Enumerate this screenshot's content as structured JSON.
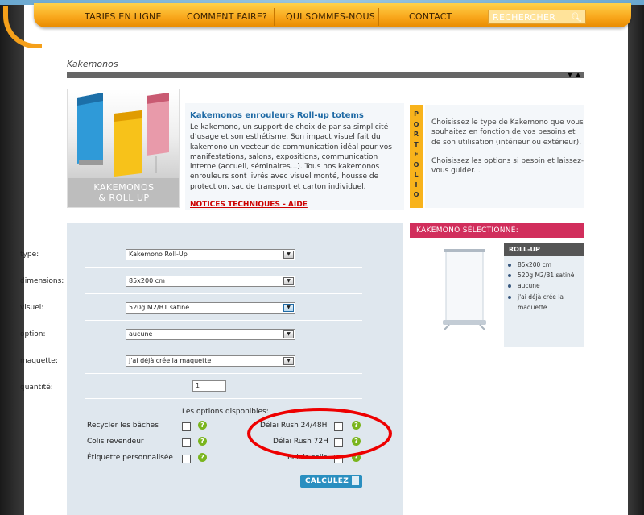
{
  "nav": {
    "items": [
      "TARIFS EN LIGNE",
      "COMMENT FAIRE?",
      "QUI SOMMES-NOUS",
      "CONTACT"
    ],
    "search_placeholder": "RECHERCHER"
  },
  "breadcrumb": "Kakemonos",
  "hero": {
    "caption_line1": "KAKEMONOS",
    "caption_line2": "& ROLL UP"
  },
  "description": {
    "title": "Kakemonos enrouleurs Roll-up totems",
    "body": "Le kakemono, un support de choix de par sa simplicité d’usage et son esthétisme. Son impact visuel fait du kakemono un vecteur de communication idéal pour vos manifestations, salons, expositions, communication interne (accueil, séminaires...). Tous nos kakemonos enrouleurs sont livrés avec visuel monté, housse de protection, sac de transport et carton individuel.",
    "link": "NOTICES TECHNIQUES - AIDE"
  },
  "portfolio_letters": [
    "P",
    "O",
    "R",
    "T",
    "F",
    "O",
    "L",
    "I",
    "O"
  ],
  "help": {
    "p1": "Choisissez le type de Kakemono que vous souhaitez en fonction de vos besoins et de son utilisation (intérieur ou extérieur).",
    "p2": "Choisissez les options si besoin et laissez-vous guider..."
  },
  "form": {
    "fields": [
      {
        "label": "type:",
        "value": "Kakemono Roll-Up"
      },
      {
        "label": "dimensions:",
        "value": "85x200 cm"
      },
      {
        "label": "visuel:",
        "value": "520g M2/B1 satiné"
      },
      {
        "label": "option:",
        "value": "aucune"
      },
      {
        "label": "maquette:",
        "value": "j'ai déjà crée la maquette"
      }
    ],
    "quantity_label": "quantité:",
    "quantity_value": "1",
    "options_title": "Les options disponibles:",
    "options_left": [
      "Recycler les bâches",
      "Colis revendeur",
      "Étiquette personnalisée"
    ],
    "options_right": [
      "Délai Rush 24/48H",
      "Délai Rush 72H",
      "Relais colis"
    ],
    "calc_label": "CALCULEZ",
    "help_glyph": "?"
  },
  "selected": {
    "header": "KAKEMONO SÉLECTIONNÉ:",
    "product": "ROLL-UP",
    "items": [
      "85x200 cm",
      "520g M2/B1 satiné",
      "aucune",
      "j'ai déjà crée la",
      "maquette"
    ]
  },
  "colors": {
    "accent_orange": "#f8a51a",
    "link_blue": "#1f6aa5",
    "selected_pink": "#d12e5c",
    "highlight_red": "#e00000",
    "help_green": "#7ab51d"
  }
}
